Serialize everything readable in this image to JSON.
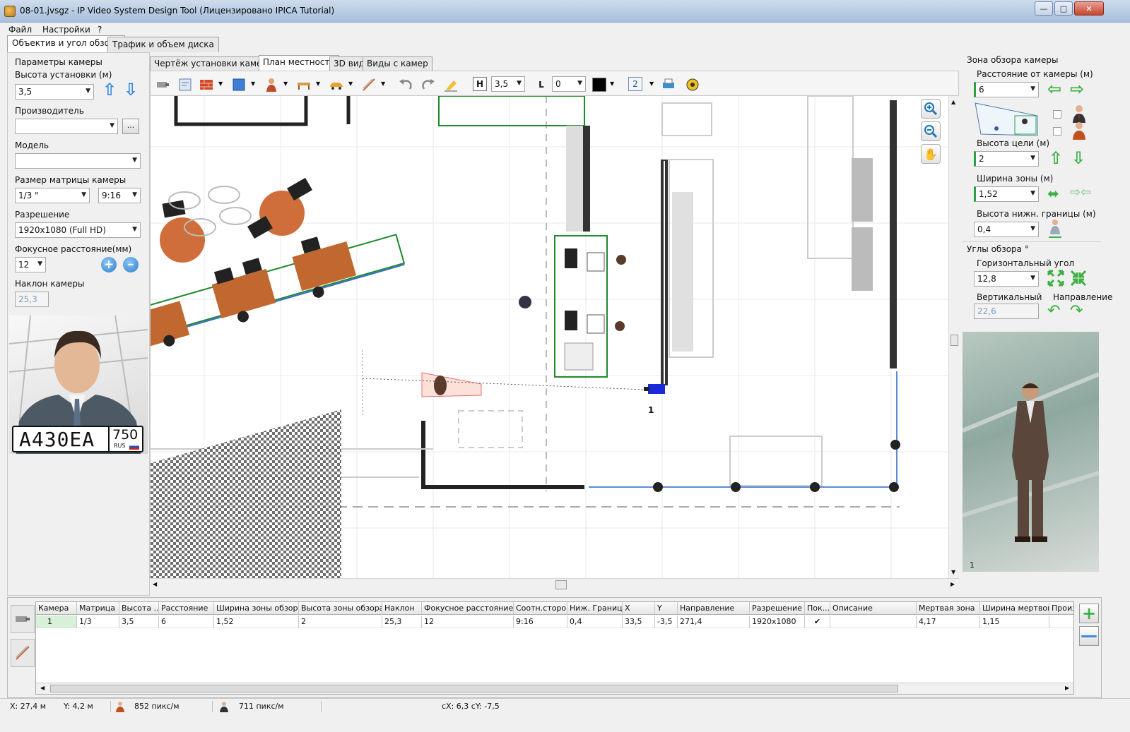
{
  "window": {
    "title": "08-01.jvsgz - IP Video System Design Tool (Лицензировано  IPICA Tutorial)"
  },
  "menu": {
    "file": "Файл",
    "settings": "Настройки",
    "help": "?"
  },
  "outer_tabs": {
    "lens": "Объектив и угол обзора",
    "traffic": "Трафик и объем диска"
  },
  "left": {
    "group": "Параметры камеры",
    "height_label": "Высота установки (м)",
    "height_value": "3,5",
    "maker_label": "Производитель",
    "maker_value": "",
    "maker_btn": "...",
    "model_label": "Модель",
    "model_value": "",
    "matrix_label": "Размер матрицы камеры",
    "matrix_value": "1/3 \"",
    "aspect_value": "9:16",
    "res_label": "Разрешение",
    "res_value": "1920x1080 (Full HD)",
    "focal_label": "Фокусное расстояние(мм)",
    "focal_value": "12",
    "tilt_label": "Наклон камеры",
    "tilt_value": "25,3",
    "plate_text": "A430EA",
    "plate_region": "750",
    "plate_country": "RUS"
  },
  "center_tabs": {
    "drawing": "Чертёж установки камеры",
    "plan": "План местности",
    "view3d": "3D вид",
    "cams": "Виды с камер"
  },
  "toolbar": {
    "height_value": "3,5",
    "level_value": "0",
    "layer_value": "2",
    "h_glyph": "H",
    "l_glyph": "L"
  },
  "canvas": {
    "camera_label": "1"
  },
  "right": {
    "zone_group": "Зона обзора камеры",
    "distance_label": "Расстояние от камеры (м)",
    "distance_value": "6",
    "target_label": "Высота цели (м)",
    "target_value": "2",
    "width_label": "Ширина зоны (м)",
    "width_value": "1,52",
    "lower_label": "Высота нижн. границы (м)",
    "lower_value": "0,4",
    "angles_group": "Углы обзора °",
    "hangle_label": "Горизонтальный угол",
    "hangle_value": "12,8",
    "vangle_label": "Вертикальный",
    "vangle_value": "22,6",
    "dir_label": "Направление",
    "preview_marker": "1"
  },
  "table": {
    "headers": [
      "Камера",
      "Матрица",
      "Высота ...",
      "Расстояние",
      "Ширина зоны обзора",
      "Высота зоны обзора",
      "Наклон",
      "Фокусное расстояние",
      "Соотн.сторон",
      "Ниж. Граница",
      "X",
      "Y",
      "Направление",
      "Разрешение",
      "Пок...",
      "Описание",
      "Мертвая зона",
      "Ширина мертвой...",
      "Произ"
    ],
    "row": [
      "1",
      "1/3",
      "3,5",
      "6",
      "1,52",
      "2",
      "25,3",
      "12",
      "9:16",
      "0,4",
      "33,5",
      "-3,5",
      "271,4",
      "1920x1080",
      "✔",
      "",
      "4,17",
      "1,15",
      ""
    ]
  },
  "status": {
    "x": "X: 27,4 м",
    "y": "Y: 4,2 м",
    "ppm1": "852 пикс/м",
    "ppm2": "711 пикс/м",
    "cxy": "cX: 6,3 cY: -7,5"
  }
}
